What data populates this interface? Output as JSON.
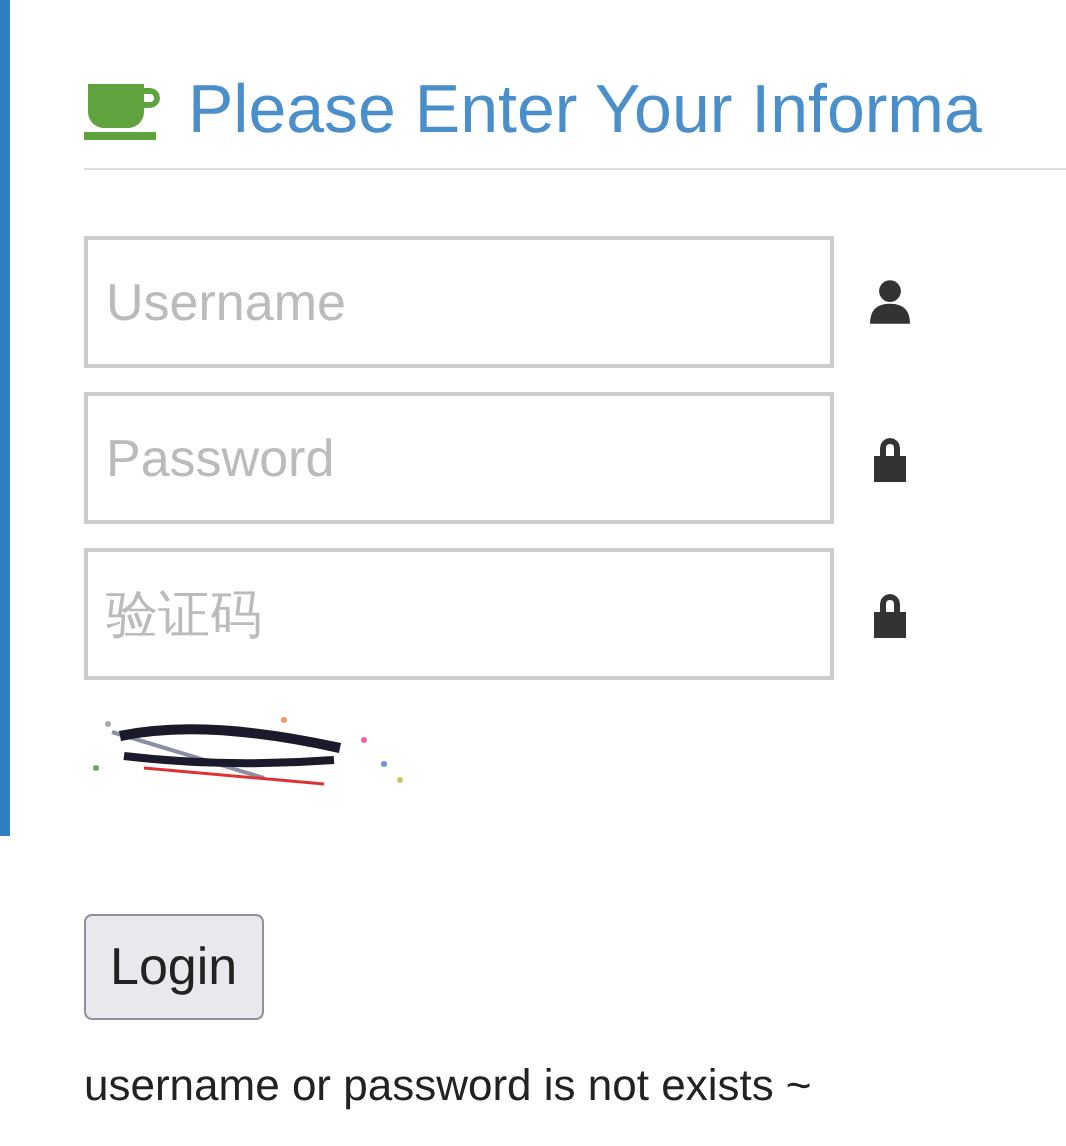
{
  "heading": {
    "title": "Please Enter Your Informa"
  },
  "fields": [
    {
      "placeholder": "Username",
      "kind": "user"
    },
    {
      "placeholder": "Password",
      "kind": "lock"
    },
    {
      "placeholder": "验证码",
      "kind": "lock"
    }
  ],
  "login_button": "Login",
  "message": "username or password is not exists ~"
}
